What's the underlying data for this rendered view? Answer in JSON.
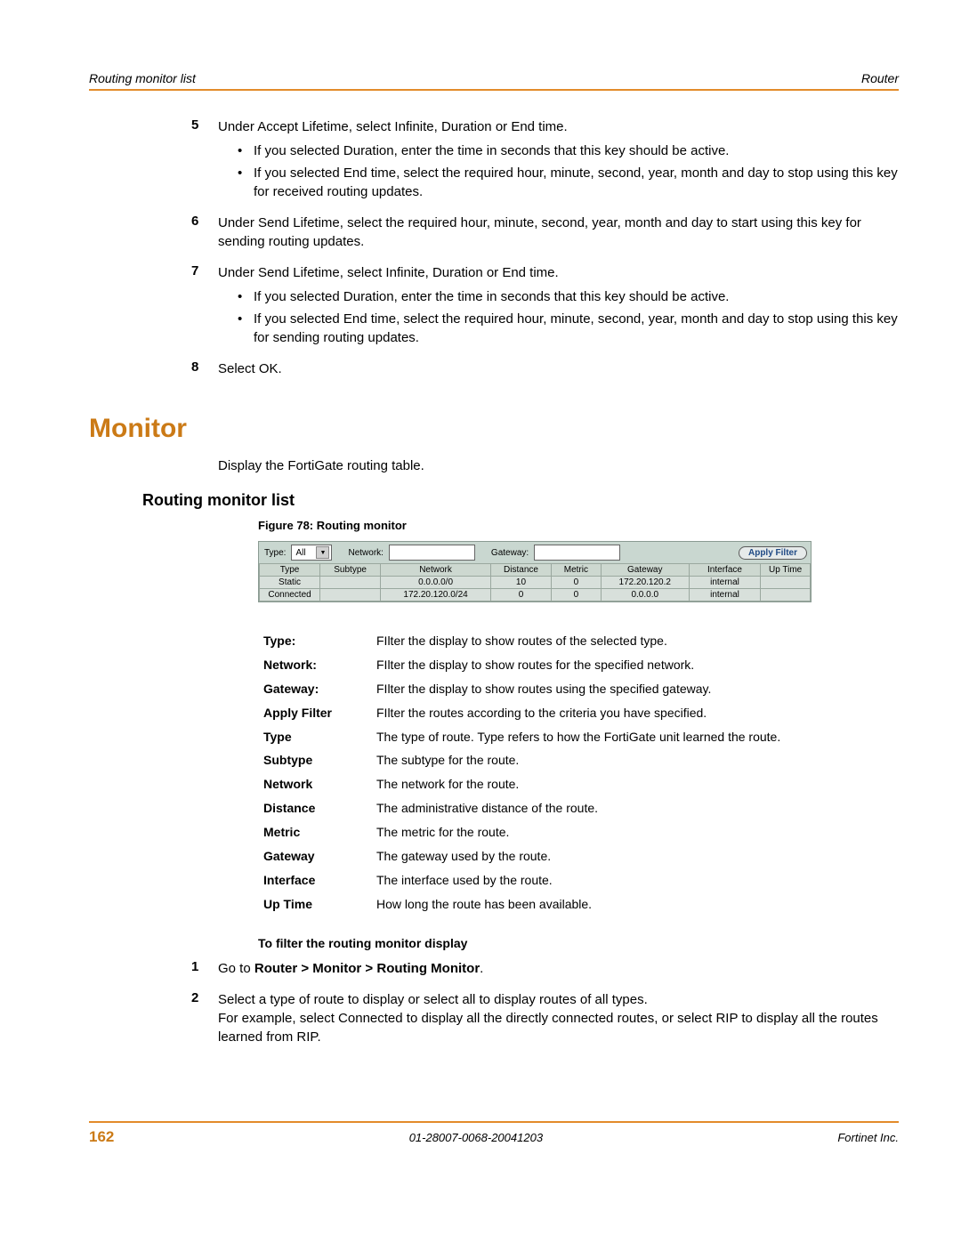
{
  "header": {
    "left": "Routing monitor list",
    "right": "Router"
  },
  "steps_top": [
    {
      "num": "5",
      "text": "Under Accept Lifetime, select Infinite, Duration or End time.",
      "bullets": [
        "If you selected Duration, enter the time in seconds that this key should be active.",
        "If you selected End time, select the required hour, minute, second, year, month and day to stop using this key for received routing updates."
      ]
    },
    {
      "num": "6",
      "text": "Under Send Lifetime, select the required hour, minute, second, year, month and day to start using this key for sending routing updates.",
      "bullets": []
    },
    {
      "num": "7",
      "text": "Under Send Lifetime, select Infinite, Duration or End time.",
      "bullets": [
        "If you selected Duration, enter the time in seconds that this key should be active.",
        "If you selected End time, select the required hour, minute, second, year, month and day to stop using this key for sending routing updates."
      ]
    },
    {
      "num": "8",
      "text": "Select OK.",
      "bullets": []
    }
  ],
  "section_heading": "Monitor",
  "intro": "Display the FortiGate routing table.",
  "subheading": "Routing monitor list",
  "figure_caption": "Figure 78: Routing monitor",
  "figure": {
    "labels": {
      "type": "Type:",
      "network": "Network:",
      "gateway": "Gateway:"
    },
    "type_value": "All",
    "apply_btn": "Apply Filter",
    "cols": [
      "Type",
      "Subtype",
      "Network",
      "Distance",
      "Metric",
      "Gateway",
      "Interface",
      "Up Time"
    ],
    "rows": [
      [
        "Static",
        "",
        "0.0.0.0/0",
        "10",
        "0",
        "172.20.120.2",
        "internal",
        ""
      ],
      [
        "Connected",
        "",
        "172.20.120.0/24",
        "0",
        "0",
        "0.0.0.0",
        "internal",
        ""
      ]
    ]
  },
  "definitions": [
    {
      "term": "Type:",
      "desc": "FIlter the display to show routes of the selected type."
    },
    {
      "term": "Network:",
      "desc": "FIlter the display to show routes for the specified network."
    },
    {
      "term": "Gateway:",
      "desc": "FIlter the display to show routes using the specified gateway."
    },
    {
      "term": "Apply Filter",
      "desc": "FIlter the routes according to the criteria you have specified."
    },
    {
      "term": "Type",
      "desc": "The type of route. Type refers to how the FortiGate unit learned the route."
    },
    {
      "term": "Subtype",
      "desc": "The subtype for the route."
    },
    {
      "term": "Network",
      "desc": "The network for the route."
    },
    {
      "term": "Distance",
      "desc": "The administrative distance of the route."
    },
    {
      "term": "Metric",
      "desc": "The metric for the route."
    },
    {
      "term": "Gateway",
      "desc": "The gateway used by the route."
    },
    {
      "term": "Interface",
      "desc": "The interface used by the route."
    },
    {
      "term": "Up Time",
      "desc": "How long the route has been available."
    }
  ],
  "procedure": {
    "heading": "To filter the routing monitor display",
    "steps": [
      {
        "num": "1",
        "pre": "Go to ",
        "bold": "Router > Monitor > Routing Monitor",
        "post": ".",
        "extra": ""
      },
      {
        "num": "2",
        "pre": "Select a type of route to display or select all to display routes of all types.",
        "bold": "",
        "post": "",
        "extra": "For example, select Connected to display all the directly connected routes, or select RIP to display all the routes learned from RIP."
      }
    ]
  },
  "footer": {
    "page": "162",
    "docid": "01-28007-0068-20041203",
    "company": "Fortinet Inc."
  }
}
